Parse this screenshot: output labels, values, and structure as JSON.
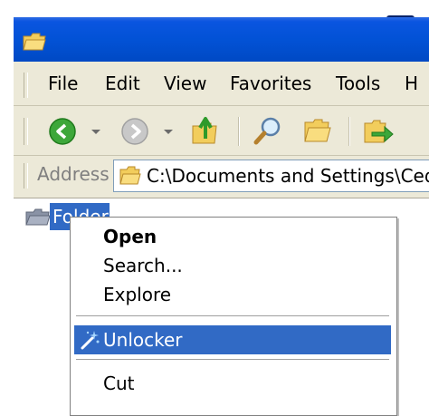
{
  "window": {
    "menu": [
      "File",
      "Edit",
      "View",
      "Favorites",
      "Tools",
      "H"
    ]
  },
  "address": {
    "label": "Address",
    "value": "C:\\Documents and Settings\\Ced"
  },
  "tree": {
    "selected_label": "Folder"
  },
  "context_menu": {
    "items": [
      {
        "label": "Open",
        "bold": true
      },
      {
        "label": "Search..."
      },
      {
        "label": "Explore"
      },
      {
        "label": "Unlocker",
        "selected": true,
        "icon": "unlocker-wand-icon"
      },
      {
        "label": "Cut"
      }
    ]
  },
  "colors": {
    "titlebar": "#0252d6",
    "chrome": "#ece9d8",
    "selection": "#316ac5",
    "close_border": "#0a246a"
  }
}
